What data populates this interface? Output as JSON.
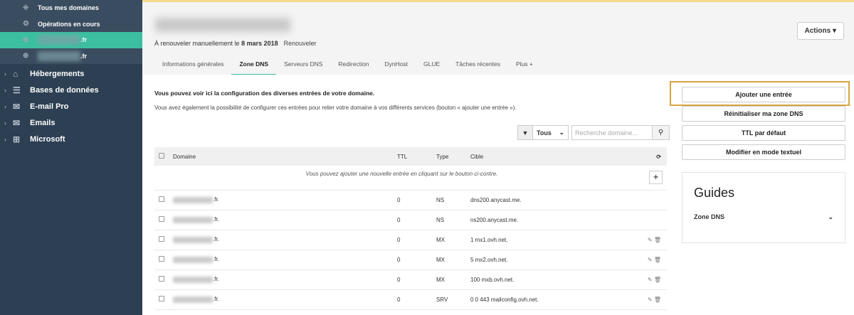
{
  "sidebar": {
    "sub": [
      {
        "label": "Tous mes domaines",
        "icon": "network-icon"
      },
      {
        "label": "Opérations en cours",
        "icon": "gear-icon"
      },
      {
        "label": ".fr",
        "icon": "globe-icon",
        "active": true
      },
      {
        "label": ".fr",
        "icon": "globe-icon"
      }
    ],
    "items": [
      {
        "label": "Hébergements"
      },
      {
        "label": "Bases de données"
      },
      {
        "label": "E-mail Pro"
      },
      {
        "label": "Emails"
      },
      {
        "label": "Microsoft"
      }
    ]
  },
  "header": {
    "renew_text": "À renouveler manuellement le",
    "renew_date": "8 mars 2018",
    "renew_link": "Renouveler",
    "actions": "Actions"
  },
  "tabs": [
    "Informations générales",
    "Zone DNS",
    "Serveurs DNS",
    "Redirection",
    "DynHost",
    "GLUE",
    "Tâches récentes",
    "Plus +"
  ],
  "intro": {
    "line1": "Vous pouvez voir ici la configuration des diverses entrées de votre domaine.",
    "line2": "Vous avez également la possibilité de configurer ces entrées pour relier votre domaine à vos différents services (bouton « ajouter une entrée »)."
  },
  "filter": {
    "selected": "Tous",
    "placeholder": "Recherche domaine..."
  },
  "table": {
    "headers": [
      "Domaine",
      "TTL",
      "Type",
      "Cible"
    ],
    "info": "Vous pouvez ajouter une nouvelle entrée en cliquant sur le bouton ci-contre.",
    "rows": [
      {
        "domain": ".fr.",
        "ttl": "0",
        "type": "NS",
        "target": "dns200.anycast.me."
      },
      {
        "domain": ".fr.",
        "ttl": "0",
        "type": "NS",
        "target": "ns200.anycast.me."
      },
      {
        "domain": ".fr.",
        "ttl": "0",
        "type": "MX",
        "target": "1 mx1.ovh.net."
      },
      {
        "domain": ".fr.",
        "ttl": "0",
        "type": "MX",
        "target": "5 mx2.ovh.net."
      },
      {
        "domain": ".fr.",
        "ttl": "0",
        "type": "MX",
        "target": "100 mxb.ovh.net."
      },
      {
        "domain": ".fr.",
        "ttl": "0",
        "type": "SRV",
        "target": "0 0 443 mailconfig.ovh.net."
      }
    ]
  },
  "buttons": [
    "Ajouter une entrée",
    "Réinitialiser ma zone DNS",
    "TTL par défaut",
    "Modifier en mode textuel"
  ],
  "guides": {
    "title": "Guides",
    "item": "Zone DNS"
  }
}
